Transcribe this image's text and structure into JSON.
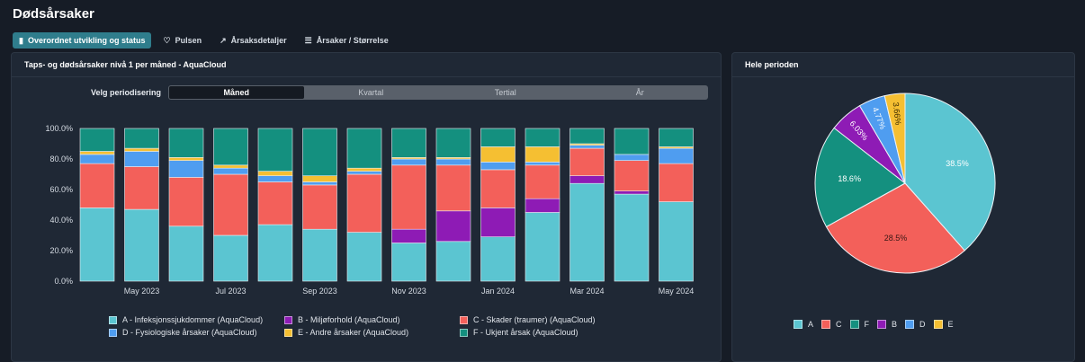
{
  "app": {
    "title": "Dødsårsaker"
  },
  "tabs": [
    {
      "label": "Overordnet utvikling og status",
      "icon": "bar-chart-icon",
      "active": true
    },
    {
      "label": "Pulsen",
      "icon": "heart-icon",
      "active": false
    },
    {
      "label": "Årsaksdetaljer",
      "icon": "line-chart-icon",
      "active": false
    },
    {
      "label": "Årsaker / Størrelse",
      "icon": "list-icon",
      "active": false
    }
  ],
  "left_panel": {
    "title": "Taps- og dødsårsaker nivå 1 per måned - AquaCloud",
    "period_label": "Velg periodisering",
    "period_options": [
      "Måned",
      "Kvartal",
      "Tertial",
      "År"
    ],
    "period_selected": "Måned"
  },
  "right_panel": {
    "title": "Hele perioden"
  },
  "legend": [
    {
      "key": "A",
      "label": "A - Infeksjonssjukdommer (AquaCloud)",
      "color": "#5bc5d1"
    },
    {
      "key": "B",
      "label": "B - Miljøforhold (AquaCloud)",
      "color": "#8e1bb5"
    },
    {
      "key": "C",
      "label": "C - Skader (traumer) (AquaCloud)",
      "color": "#f3605a"
    },
    {
      "key": "D",
      "label": "D - Fysiologiske årsaker (AquaCloud)",
      "color": "#4f9df0"
    },
    {
      "key": "E",
      "label": "E - Andre årsaker (AquaCloud)",
      "color": "#f5bf32"
    },
    {
      "key": "F",
      "label": "F - Ukjent årsak (AquaCloud)",
      "color": "#14907f"
    }
  ],
  "colors": {
    "A": "#5bc5d1",
    "B": "#8e1bb5",
    "C": "#f3605a",
    "D": "#4f9df0",
    "E": "#f5bf32",
    "F": "#14907f"
  },
  "chart_data": [
    {
      "type": "bar",
      "stacked": true,
      "categories": [
        "Apr 2023",
        "May 2023",
        "Jun 2023",
        "Jul 2023",
        "Aug 2023",
        "Sep 2023",
        "Oct 2023",
        "Nov 2023",
        "Dec 2023",
        "Jan 2024",
        "Feb 2024",
        "Mar 2024",
        "Apr 2024",
        "May 2024"
      ],
      "x_tick_labels": [
        "May 2023",
        "Jul 2023",
        "Sep 2023",
        "Nov 2023",
        "Jan 2024",
        "Mar 2024",
        "May 2024"
      ],
      "y_tick_labels": [
        "0.0%",
        "20.0%",
        "40.0%",
        "60.0%",
        "80.0%",
        "100.0%"
      ],
      "ylim": [
        0,
        100
      ],
      "series": [
        {
          "key": "A",
          "values": [
            48,
            47,
            36,
            30,
            37,
            34,
            32,
            25,
            26,
            29,
            45,
            64,
            57,
            52
          ]
        },
        {
          "key": "B",
          "values": [
            0,
            0,
            0,
            0,
            0,
            0,
            0,
            9,
            20,
            19,
            9,
            5,
            2,
            0
          ]
        },
        {
          "key": "C",
          "values": [
            29,
            28,
            32,
            40,
            28,
            29,
            38,
            42,
            30,
            25,
            22,
            18,
            20,
            25
          ]
        },
        {
          "key": "D",
          "values": [
            6,
            10,
            11,
            4,
            4,
            2,
            2,
            4,
            4,
            5,
            2,
            2,
            4,
            10
          ]
        },
        {
          "key": "E",
          "values": [
            2,
            2,
            2,
            2,
            3,
            4,
            2,
            1,
            1,
            10,
            10,
            1,
            0,
            1
          ]
        },
        {
          "key": "F",
          "values": [
            15,
            13,
            19,
            24,
            28,
            31,
            26,
            19,
            19,
            12,
            12,
            10,
            17,
            12
          ]
        }
      ]
    },
    {
      "type": "pie",
      "slices": [
        {
          "key": "A",
          "value": 38.5,
          "label": "38.5%"
        },
        {
          "key": "C",
          "value": 28.5,
          "label": "28.5%"
        },
        {
          "key": "F",
          "value": 18.6,
          "label": "18.6%"
        },
        {
          "key": "B",
          "value": 6.03,
          "label": "6.03%"
        },
        {
          "key": "D",
          "value": 4.77,
          "label": "4.77%"
        },
        {
          "key": "E",
          "value": 3.66,
          "label": "3.66%"
        }
      ],
      "legend_order": [
        "A",
        "C",
        "F",
        "B",
        "D",
        "E"
      ],
      "legend_placement": "bottom"
    }
  ]
}
